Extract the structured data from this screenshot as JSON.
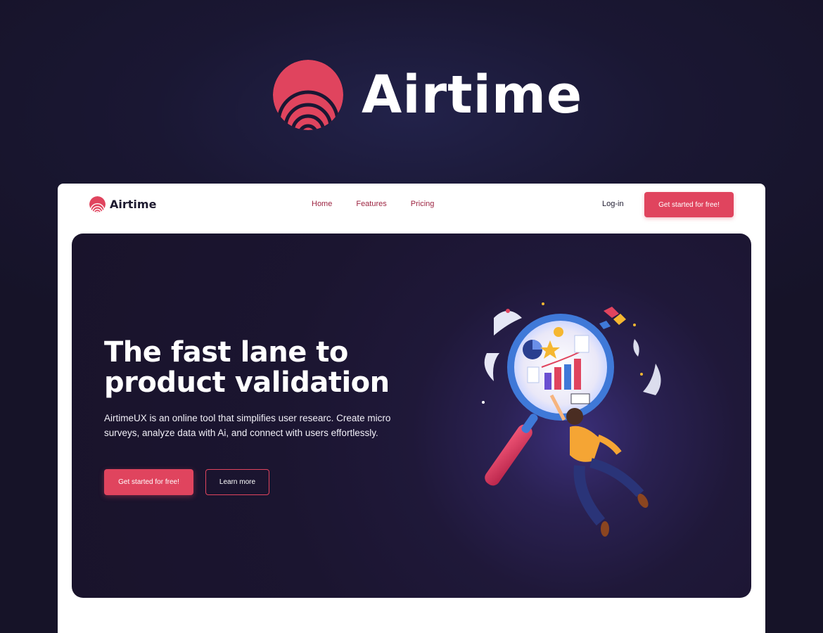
{
  "brand": {
    "name": "Airtime",
    "accent_color": "#e0445e",
    "background_color": "#1a1733"
  },
  "nav": {
    "brand_name": "Airtime",
    "links": [
      "Home",
      "Features",
      "Pricing"
    ],
    "login_label": "Log-in",
    "cta_label": "Get started for free!"
  },
  "hero": {
    "title": "The fast lane to product validation",
    "description": "AirtimeUX is an online tool that simplifies user researc. Create micro surveys, analyze data with Ai, and connect with users effortlessly.",
    "primary_cta": "Get started for free!",
    "secondary_cta": "Learn more",
    "illustration_icon": "magnifier-research-illustration"
  }
}
